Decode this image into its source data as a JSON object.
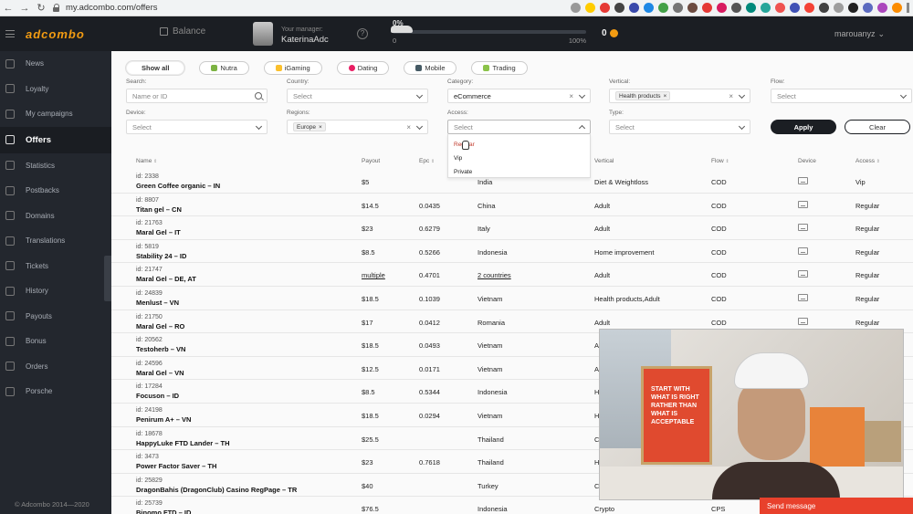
{
  "browser": {
    "back": "←",
    "forward": "→",
    "reload": "↻",
    "url": "my.adcombo.com/offers"
  },
  "header": {
    "logo": "adcombo",
    "balance_label": "Balance",
    "manager_label": "Your manager:",
    "manager_name": "KaterinaAdc",
    "info": "?",
    "progress_pct": "0%",
    "progress_value": 0,
    "progress_min": "0",
    "progress_max": "100%",
    "coins": "0",
    "user": "marouanyz",
    "user_caret": "⌄"
  },
  "sidebar": {
    "items": [
      {
        "label": "News",
        "icon": "news-icon"
      },
      {
        "label": "Loyalty",
        "icon": "loyalty-icon"
      },
      {
        "label": "My campaigns",
        "icon": "campaigns-icon"
      },
      {
        "label": "Offers",
        "icon": "offers-icon",
        "active": true
      },
      {
        "label": "Statistics",
        "icon": "statistics-icon"
      },
      {
        "label": "Postbacks",
        "icon": "postbacks-icon"
      },
      {
        "label": "Domains",
        "icon": "domains-icon"
      },
      {
        "label": "Translations",
        "icon": "translations-icon"
      },
      {
        "label": "Tickets",
        "icon": "tickets-icon"
      },
      {
        "label": "History",
        "icon": "history-icon"
      },
      {
        "label": "Payouts",
        "icon": "payouts-icon"
      },
      {
        "label": "Bonus",
        "icon": "bonus-icon"
      },
      {
        "label": "Orders",
        "icon": "orders-icon"
      },
      {
        "label": "Porsche",
        "icon": "porsche-icon"
      }
    ],
    "footer": "© Adcombo 2014—2020"
  },
  "chips": [
    "Show all",
    "Nutra",
    "iGaming",
    "Dating",
    "Mobile",
    "Trading"
  ],
  "filters": {
    "search_label": "Search:",
    "search_placeholder": "Name or ID",
    "country_label": "Country:",
    "country_placeholder": "Select",
    "category_label": "Category:",
    "category_value": "eCommerce",
    "vertical_label": "Vertical:",
    "vertical_tag": "Health products",
    "flow_label": "Flow:",
    "flow_placeholder": "Select",
    "device_label": "Device:",
    "device_placeholder": "Select",
    "regions_label": "Regions:",
    "regions_tag": "Europe",
    "access_label": "Access:",
    "access_placeholder": "Select",
    "type_label": "Type:",
    "type_placeholder": "Select",
    "remove": "×",
    "apply": "Apply",
    "clear": "Clear"
  },
  "access_options": [
    "Regular",
    "Vip",
    "Private"
  ],
  "table": {
    "sort_glyph": "⇕",
    "headers": {
      "name": "Name",
      "payout": "Payout",
      "epc": "Epc",
      "vertical": "Vertical",
      "flow": "Flow",
      "device": "Device",
      "access": "Access"
    },
    "rows": [
      {
        "id": "id: 2338",
        "name": "Green Coffee organic – IN",
        "payout": "$5",
        "epc": "",
        "country": "India",
        "vertical": "Diet & Weightloss",
        "flow": "COD",
        "access": "Vip"
      },
      {
        "id": "id: 8807",
        "name": "Titan gel – CN",
        "payout": "$14.5",
        "epc": "0.0435",
        "country": "China",
        "vertical": "Adult",
        "flow": "COD",
        "access": "Regular"
      },
      {
        "id": "id: 21763",
        "name": "Maral Gel – IT",
        "payout": "$23",
        "epc": "0.6279",
        "country": "Italy",
        "vertical": "Adult",
        "flow": "COD",
        "access": "Regular"
      },
      {
        "id": "id: 5819",
        "name": "Stability 24 – ID",
        "payout": "$8.5",
        "epc": "0.5266",
        "country": "Indonesia",
        "vertical": "Home improvement",
        "flow": "COD",
        "access": "Regular"
      },
      {
        "id": "id: 21747",
        "name": "Maral Gel – DE, AT",
        "payout": "multiple",
        "epc": "0.4701",
        "country": "2 countries",
        "vertical": "Adult",
        "flow": "COD",
        "access": "Regular"
      },
      {
        "id": "id: 24839",
        "name": "Menlust – VN",
        "payout": "$18.5",
        "epc": "0.1039",
        "country": "Vietnam",
        "vertical": "Health products,Adult",
        "flow": "COD",
        "access": "Regular"
      },
      {
        "id": "id: 21750",
        "name": "Maral Gel – RO",
        "payout": "$17",
        "epc": "0.0412",
        "country": "Romania",
        "vertical": "Adult",
        "flow": "COD",
        "access": "Regular"
      },
      {
        "id": "id: 20562",
        "name": "Testoherb – VN",
        "payout": "$18.5",
        "epc": "0.0493",
        "country": "Vietnam",
        "vertical": "Ad",
        "flow": "",
        "access": ""
      },
      {
        "id": "id: 24596",
        "name": "Maral Gel – VN",
        "payout": "$12.5",
        "epc": "0.0171",
        "country": "Vietnam",
        "vertical": "Ad",
        "flow": "",
        "access": ""
      },
      {
        "id": "id: 17284",
        "name": "Focuson – ID",
        "payout": "$8.5",
        "epc": "0.5344",
        "country": "Indonesia",
        "vertical": "He",
        "flow": "",
        "access": ""
      },
      {
        "id": "id: 24198",
        "name": "Penirum A+ – VN",
        "payout": "$18.5",
        "epc": "0.0294",
        "country": "Vietnam",
        "vertical": "He",
        "flow": "",
        "access": ""
      },
      {
        "id": "id: 18678",
        "name": "HappyLuke FTD Lander – TH",
        "payout": "$25.5",
        "epc": "",
        "country": "Thailand",
        "vertical": "Ca",
        "flow": "",
        "access": ""
      },
      {
        "id": "id: 3473",
        "name": "Power Factor Saver – TH",
        "payout": "$23",
        "epc": "0.7618",
        "country": "Thailand",
        "vertical": "Ho",
        "flow": "",
        "access": ""
      },
      {
        "id": "id: 25829",
        "name": "DragonBahis (DragonClub) Casino RegPage – TR",
        "payout": "$40",
        "epc": "",
        "country": "Turkey",
        "vertical": "Ca",
        "flow": "",
        "access": ""
      },
      {
        "id": "id: 25739",
        "name": "Binomo FTD – ID",
        "payout": "$76.5",
        "epc": "",
        "country": "Indonesia",
        "vertical": "Crypto",
        "flow": "CPS",
        "access": ""
      }
    ]
  },
  "webcam": {
    "poster_lines": [
      "START WITH",
      "WHAT IS RIGHT",
      "RATHER THAN",
      "WHAT IS ACCEPTABLE"
    ]
  },
  "chat": {
    "label": "Send message"
  },
  "colors": {
    "accent": "#f39c12",
    "sidebar": "#23272e",
    "topbar": "#1b1e23",
    "chat": "#e8412c"
  }
}
